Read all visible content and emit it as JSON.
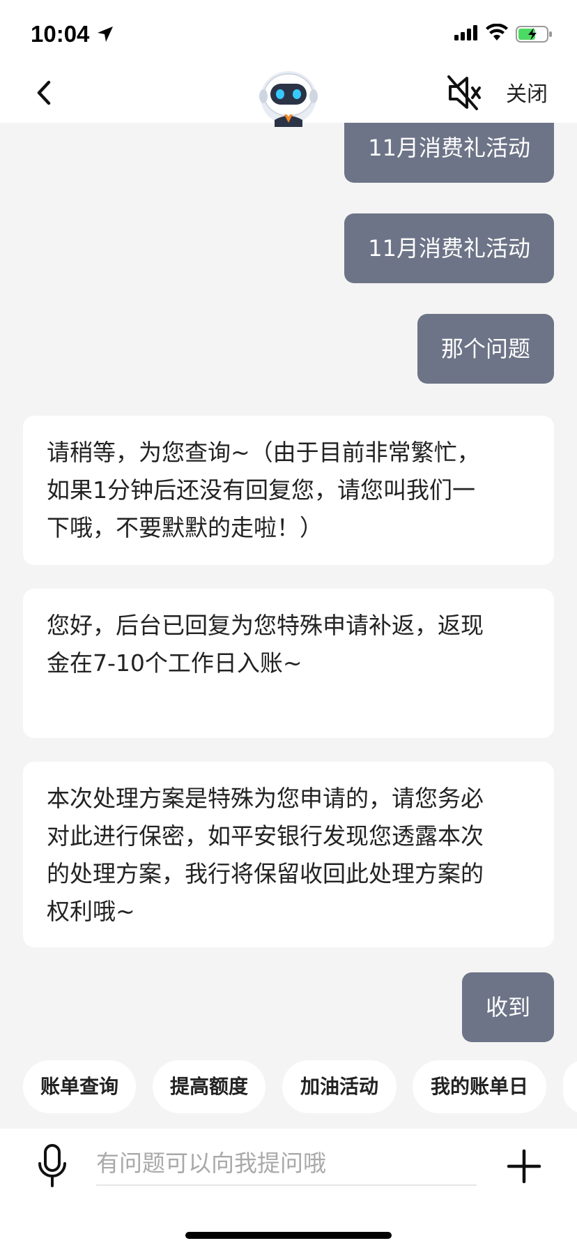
{
  "status_bar": {
    "time": "10:04"
  },
  "header": {
    "close_label": "关闭",
    "back_icon": "chevron-left-icon",
    "mute_icon": "speaker-mute-icon",
    "avatar_icon": "robot-avatar"
  },
  "messages": [
    {
      "side": "right",
      "text": "11月消费礼活动"
    },
    {
      "side": "right",
      "text": "11月消费礼活动"
    },
    {
      "side": "right",
      "text": "那个问题"
    },
    {
      "side": "left",
      "lines": [
        "请稍等，为您查询~（由于目前非常繁忙，",
        "如果1分钟后还没有回复您，请您叫我们一",
        "下哦，不要默默的走啦！）"
      ]
    },
    {
      "side": "left",
      "lines": [
        "您好，后台已回复为您特殊申请补返，返现",
        "金在7-10个工作日入账~"
      ]
    },
    {
      "side": "left",
      "lines": [
        "本次处理方案是特殊为您申请的，请您务必",
        "对此进行保密，如平安银行发现您透露本次",
        "的处理方案，我行将保留收回此处理方案的",
        "权利哦~"
      ]
    },
    {
      "side": "right",
      "text": "收到"
    }
  ],
  "quick_replies": [
    "账单查询",
    "提高额度",
    "加油活动",
    "我的账单日"
  ],
  "input": {
    "placeholder": "有问题可以向我提问哦"
  },
  "colors": {
    "user_bubble": "#6d7487",
    "bot_bubble": "#ffffff",
    "background": "#f4f4f4"
  }
}
